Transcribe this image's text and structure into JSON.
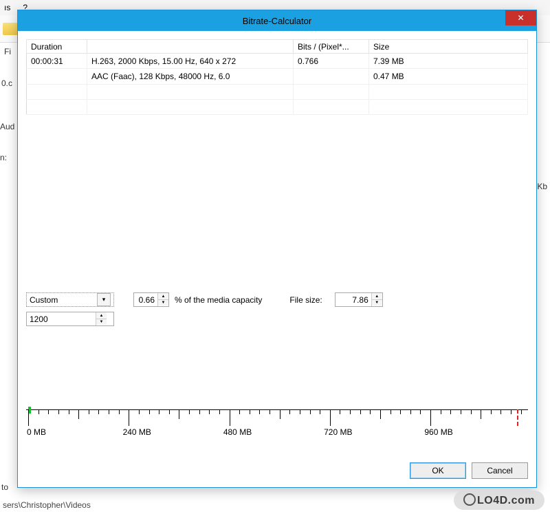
{
  "bg": {
    "menu1": "ıs",
    "menu2": "?",
    "label_fi": "Fi",
    "label_filename": "0.c",
    "label_audio": "Aud",
    "label_in": "n:",
    "label_kb": "Kb",
    "label_to": "to",
    "path": "sers\\Christopher\\Videos"
  },
  "dialog": {
    "title": "Bitrate-Calculator"
  },
  "table": {
    "headers": {
      "duration": "Duration",
      "desc": "",
      "bits": "Bits / (Pixel*...",
      "size": "Size"
    },
    "rows": [
      {
        "duration": "00:00:31",
        "desc": "H.263, 2000 Kbps, 15.00 Hz, 640 x 272",
        "bits": "0.766",
        "size": "7.39 MB"
      },
      {
        "duration": "",
        "desc": "AAC (Faac), 128 Kbps, 48000 Hz, 6.0",
        "bits": "",
        "size": "0.47 MB"
      }
    ]
  },
  "controls": {
    "media_select": "Custom",
    "pct_value": "0.66",
    "pct_label": "% of the media capacity",
    "filesize_label": "File size:",
    "filesize_value": "7.86",
    "bitrate_value": "1200"
  },
  "ruler": {
    "labels": [
      "0 MB",
      "240 MB",
      "480 MB",
      "720 MB",
      "960 MB"
    ]
  },
  "buttons": {
    "ok": "OK",
    "cancel": "Cancel"
  },
  "watermark": "LO4D.com"
}
